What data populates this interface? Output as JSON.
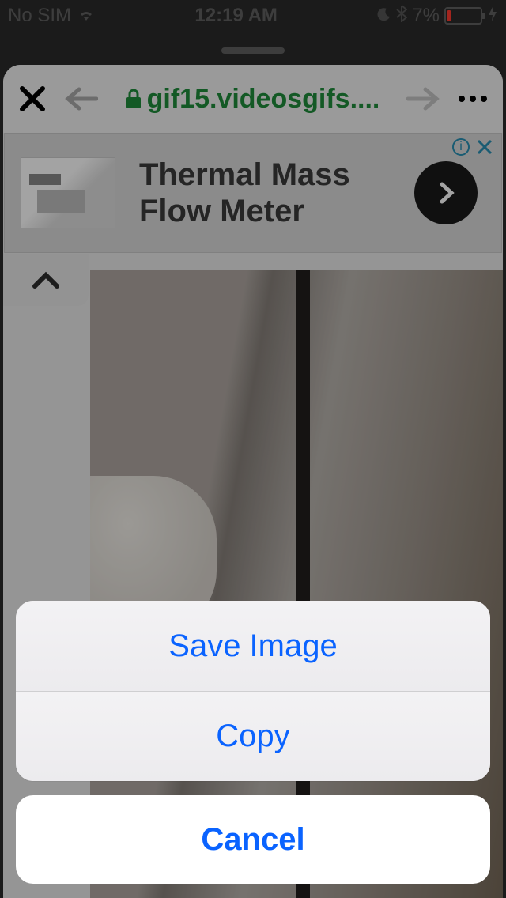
{
  "status": {
    "carrier": "No SIM",
    "time": "12:19 AM",
    "battery_pct": "7%"
  },
  "browser": {
    "url_display": "gif15.videosgifs....",
    "ad": {
      "headline_line1": "Thermal Mass",
      "headline_line2": "Flow Meter"
    }
  },
  "action_sheet": {
    "options": [
      {
        "label": "Save Image"
      },
      {
        "label": "Copy"
      }
    ],
    "cancel_label": "Cancel"
  }
}
